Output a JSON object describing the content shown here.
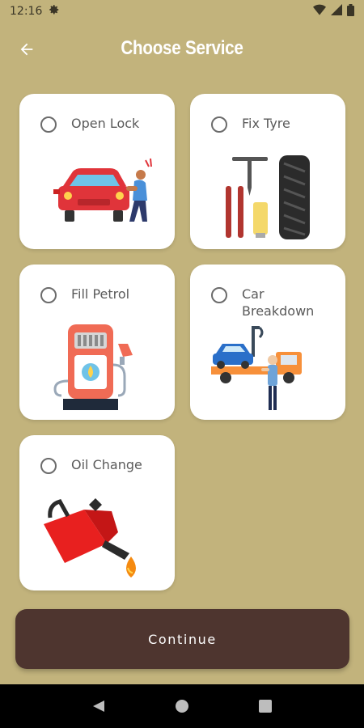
{
  "status_bar": {
    "time": "12:16",
    "icons": [
      "settings-icon",
      "wifi-icon",
      "signal-icon",
      "battery-icon"
    ]
  },
  "header": {
    "title": "Choose Service",
    "back_icon": "arrow-left-icon"
  },
  "services": [
    {
      "label": "Open Lock",
      "selected": false,
      "icon": "car-lockout-illustration"
    },
    {
      "label": "Fix Tyre",
      "selected": false,
      "icon": "tyre-repair-illustration"
    },
    {
      "label": "Fill Petrol",
      "selected": false,
      "icon": "fuel-pump-illustration"
    },
    {
      "label": "Car Breakdown",
      "selected": false,
      "icon": "tow-truck-illustration"
    },
    {
      "label": "Oil Change",
      "selected": false,
      "icon": "oil-can-illustration"
    }
  ],
  "continue_button": {
    "label": "Continue"
  },
  "nav_bar": {
    "icons": [
      "back-triangle-icon",
      "home-circle-icon",
      "recents-square-icon"
    ]
  },
  "colors": {
    "background": "#c2b37c",
    "card": "#ffffff",
    "button": "#4e352f",
    "nav": "#000000"
  }
}
